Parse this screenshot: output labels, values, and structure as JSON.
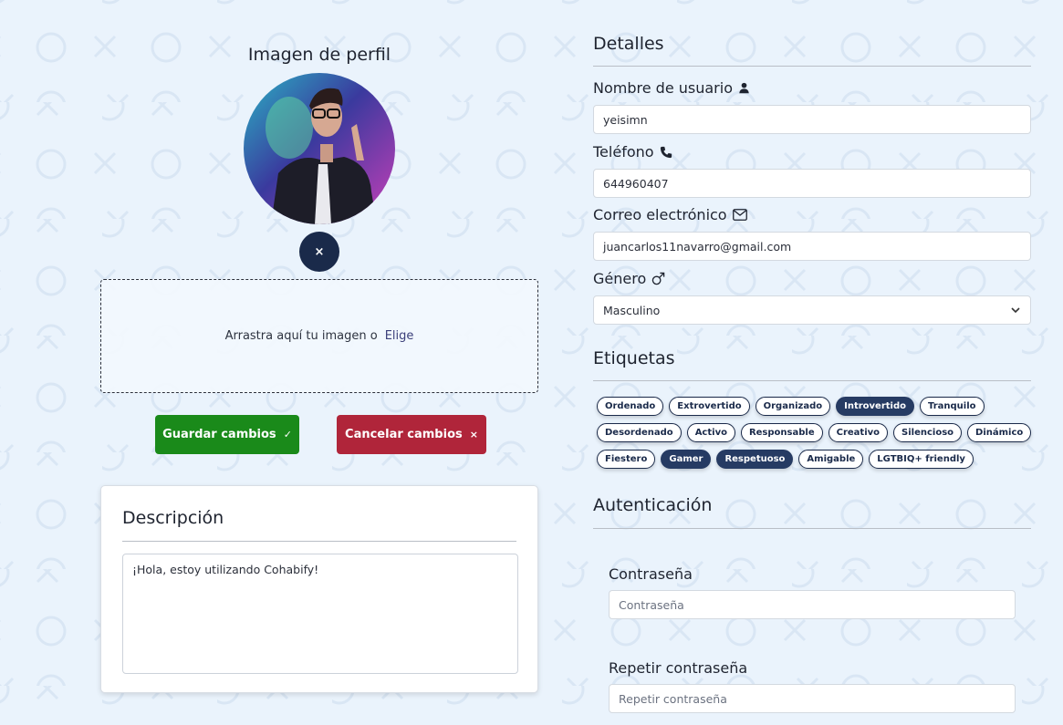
{
  "profile": {
    "title": "Imagen de perfil",
    "remove_label": "×",
    "dropzone_text": "Arrastra aquí tu imagen o",
    "dropzone_choose": "Elige",
    "save_label": "Guardar cambios",
    "save_icon": "✓",
    "cancel_label": "Cancelar cambios",
    "cancel_icon": "×"
  },
  "description": {
    "title": "Descripción",
    "value": "¡Hola, estoy utilizando Cohabify!"
  },
  "details": {
    "title": "Detalles",
    "username_label": "Nombre de usuario",
    "username_value": "yeisimn",
    "phone_label": "Teléfono",
    "phone_value": "644960407",
    "email_label": "Correo electrónico",
    "email_value": "juancarlos11navarro@gmail.com",
    "gender_label": "Género",
    "gender_value": "Masculino"
  },
  "tags": {
    "title": "Etiquetas",
    "items": [
      {
        "label": "Ordenado",
        "selected": false
      },
      {
        "label": "Extrovertido",
        "selected": false
      },
      {
        "label": "Organizado",
        "selected": false
      },
      {
        "label": "Introvertido",
        "selected": true
      },
      {
        "label": "Tranquilo",
        "selected": false
      },
      {
        "label": "Desordenado",
        "selected": false
      },
      {
        "label": "Activo",
        "selected": false
      },
      {
        "label": "Responsable",
        "selected": false
      },
      {
        "label": "Creativo",
        "selected": false
      },
      {
        "label": "Silencioso",
        "selected": false
      },
      {
        "label": "Dinámico",
        "selected": false
      },
      {
        "label": "Fiestero",
        "selected": false
      },
      {
        "label": "Gamer",
        "selected": true
      },
      {
        "label": "Respetuoso",
        "selected": true
      },
      {
        "label": "Amigable",
        "selected": false
      },
      {
        "label": "LGTBIQ+ friendly",
        "selected": false
      }
    ]
  },
  "auth": {
    "title": "Autenticación",
    "password_label": "Contraseña",
    "password_placeholder": "Contraseña",
    "repeat_label": "Repetir contraseña",
    "repeat_placeholder": "Repetir contraseña"
  },
  "colors": {
    "background": "#eaf3fc",
    "primary_dark": "#1a2a4a",
    "save": "#1a8a1a",
    "cancel": "#b0253a"
  }
}
